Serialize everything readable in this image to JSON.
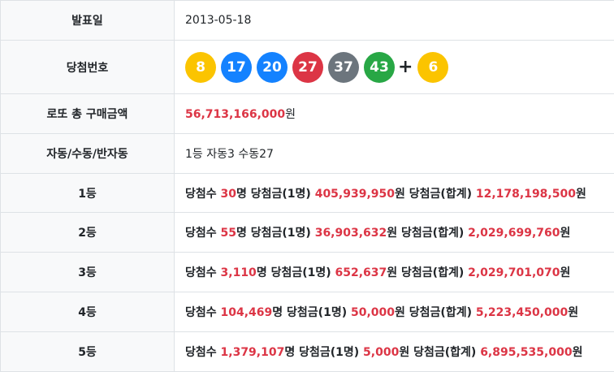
{
  "rows": {
    "date": {
      "label": "발표일",
      "value": "2013-05-18"
    },
    "numbers": {
      "label": "당첨번호",
      "balls": [
        {
          "n": "8",
          "color": "#fbc400"
        },
        {
          "n": "17",
          "color": "#1482ff"
        },
        {
          "n": "20",
          "color": "#1482ff"
        },
        {
          "n": "27",
          "color": "#dc3545"
        },
        {
          "n": "37",
          "color": "#6c757d"
        },
        {
          "n": "43",
          "color": "#28a745"
        }
      ],
      "plus": "+",
      "bonus": {
        "n": "6",
        "color": "#fbc400"
      }
    },
    "total": {
      "label": "로또 총 구매금액",
      "amount": "56,713,166,000",
      "unit": "원"
    },
    "auto": {
      "label": "자동/수동/반자동",
      "value": "1등 자동3 수동27"
    }
  },
  "terms": {
    "winners": "당첨수",
    "person_unit": "명",
    "prize_each": "당첨금(1명)",
    "prize_total": "당첨금(합계)",
    "won": "원"
  },
  "ranks": [
    {
      "label": "1등",
      "winners": "30",
      "each": "405,939,950",
      "total": "12,178,198,500"
    },
    {
      "label": "2등",
      "winners": "55",
      "each": "36,903,632",
      "total": "2,029,699,760"
    },
    {
      "label": "3등",
      "winners": "3,110",
      "each": "652,637",
      "total": "2,029,701,070"
    },
    {
      "label": "4등",
      "winners": "104,469",
      "each": "50,000",
      "total": "5,223,450,000"
    },
    {
      "label": "5등",
      "winners": "1,379,107",
      "each": "5,000",
      "total": "6,895,535,000"
    }
  ]
}
